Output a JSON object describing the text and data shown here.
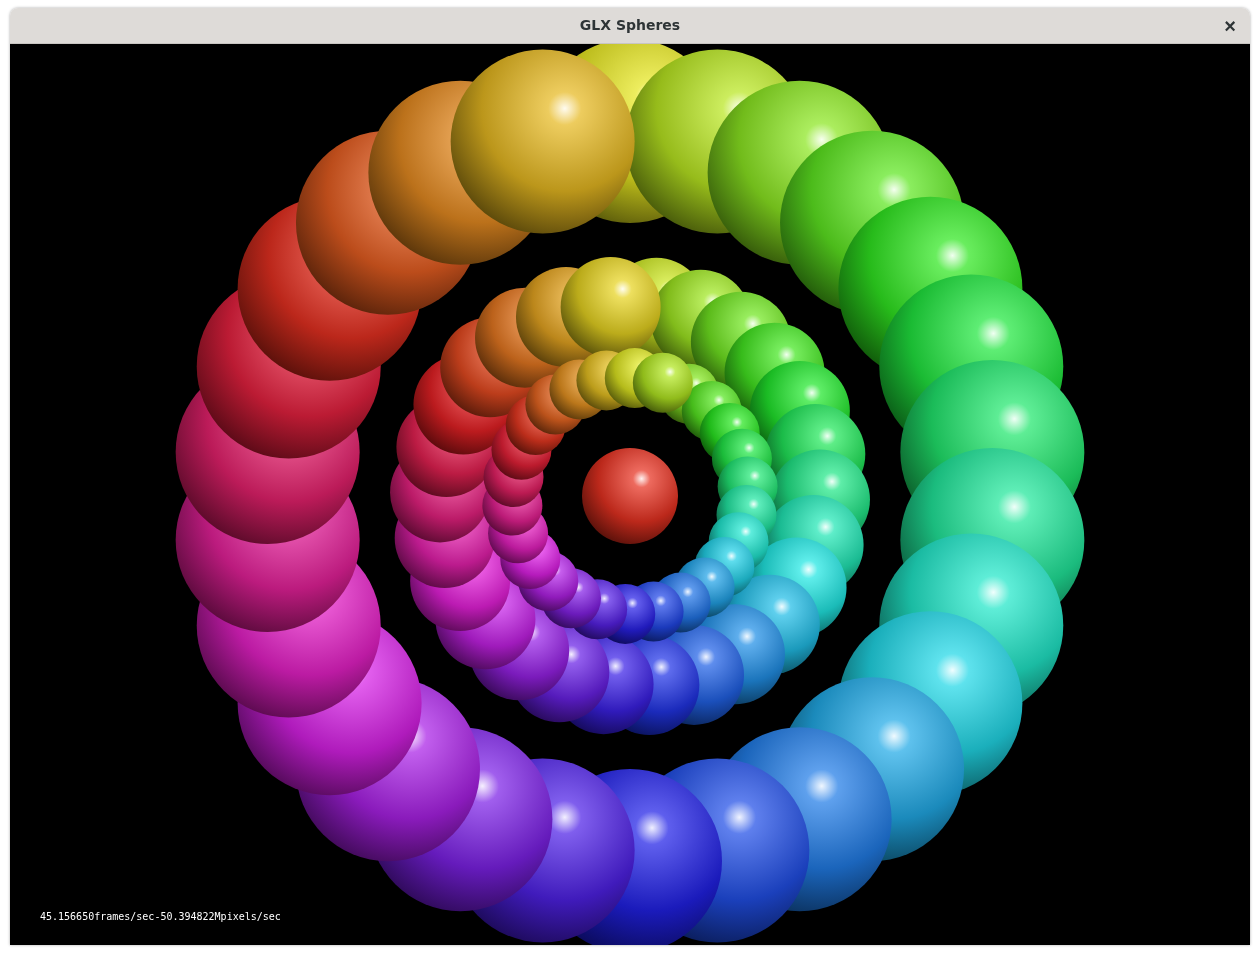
{
  "window": {
    "title": "GLX Spheres",
    "close_label": "×"
  },
  "status_text": "45.156650frames/sec-50.394822Mpixels/sec"
}
